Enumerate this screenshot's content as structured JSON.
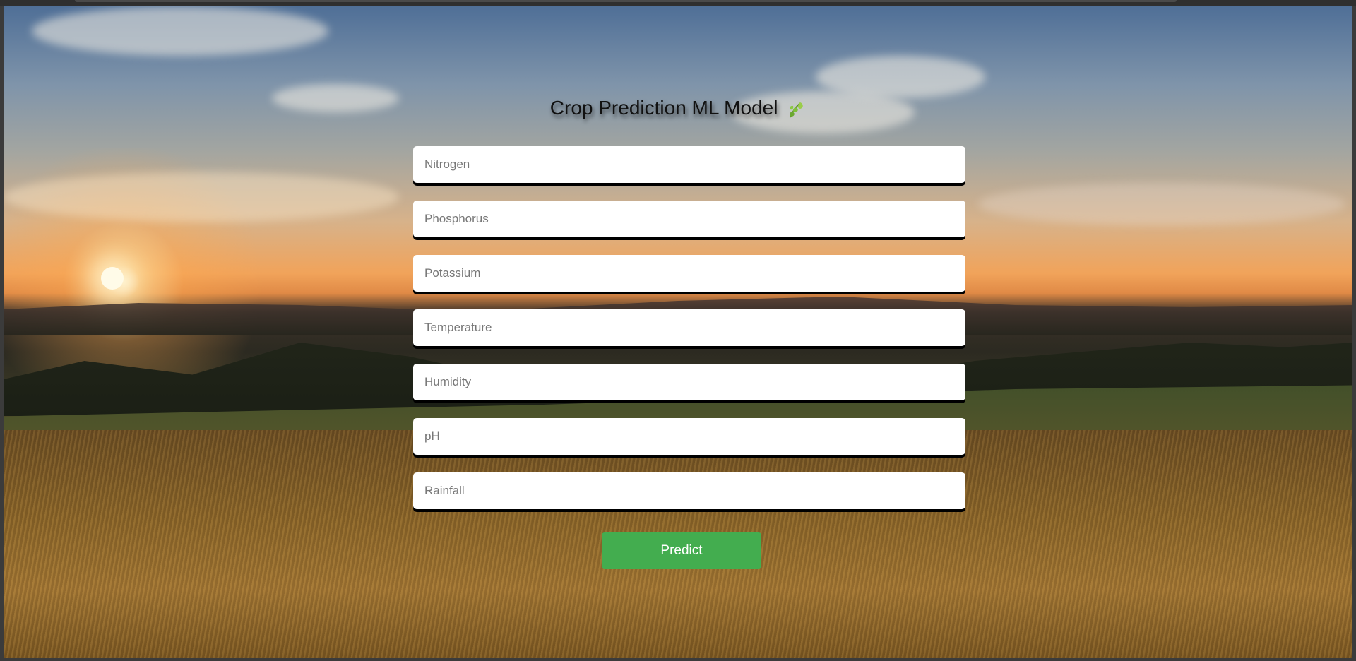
{
  "page": {
    "title": "Crop Prediction ML Model",
    "title_icon": "leaf-icon"
  },
  "form": {
    "fields": [
      {
        "name": "nitrogen",
        "placeholder": "Nitrogen",
        "value": ""
      },
      {
        "name": "phosphorus",
        "placeholder": "Phosphorus",
        "value": ""
      },
      {
        "name": "potassium",
        "placeholder": "Potassium",
        "value": ""
      },
      {
        "name": "temperature",
        "placeholder": "Temperature",
        "value": ""
      },
      {
        "name": "humidity",
        "placeholder": "Humidity",
        "value": ""
      },
      {
        "name": "ph",
        "placeholder": "pH",
        "value": ""
      },
      {
        "name": "rainfall",
        "placeholder": "Rainfall",
        "value": ""
      }
    ],
    "submit_label": "Predict"
  },
  "colors": {
    "button_bg": "#43ad4f",
    "button_text": "#ffffff",
    "field_bg": "#ffffff",
    "title_text": "#111111"
  }
}
